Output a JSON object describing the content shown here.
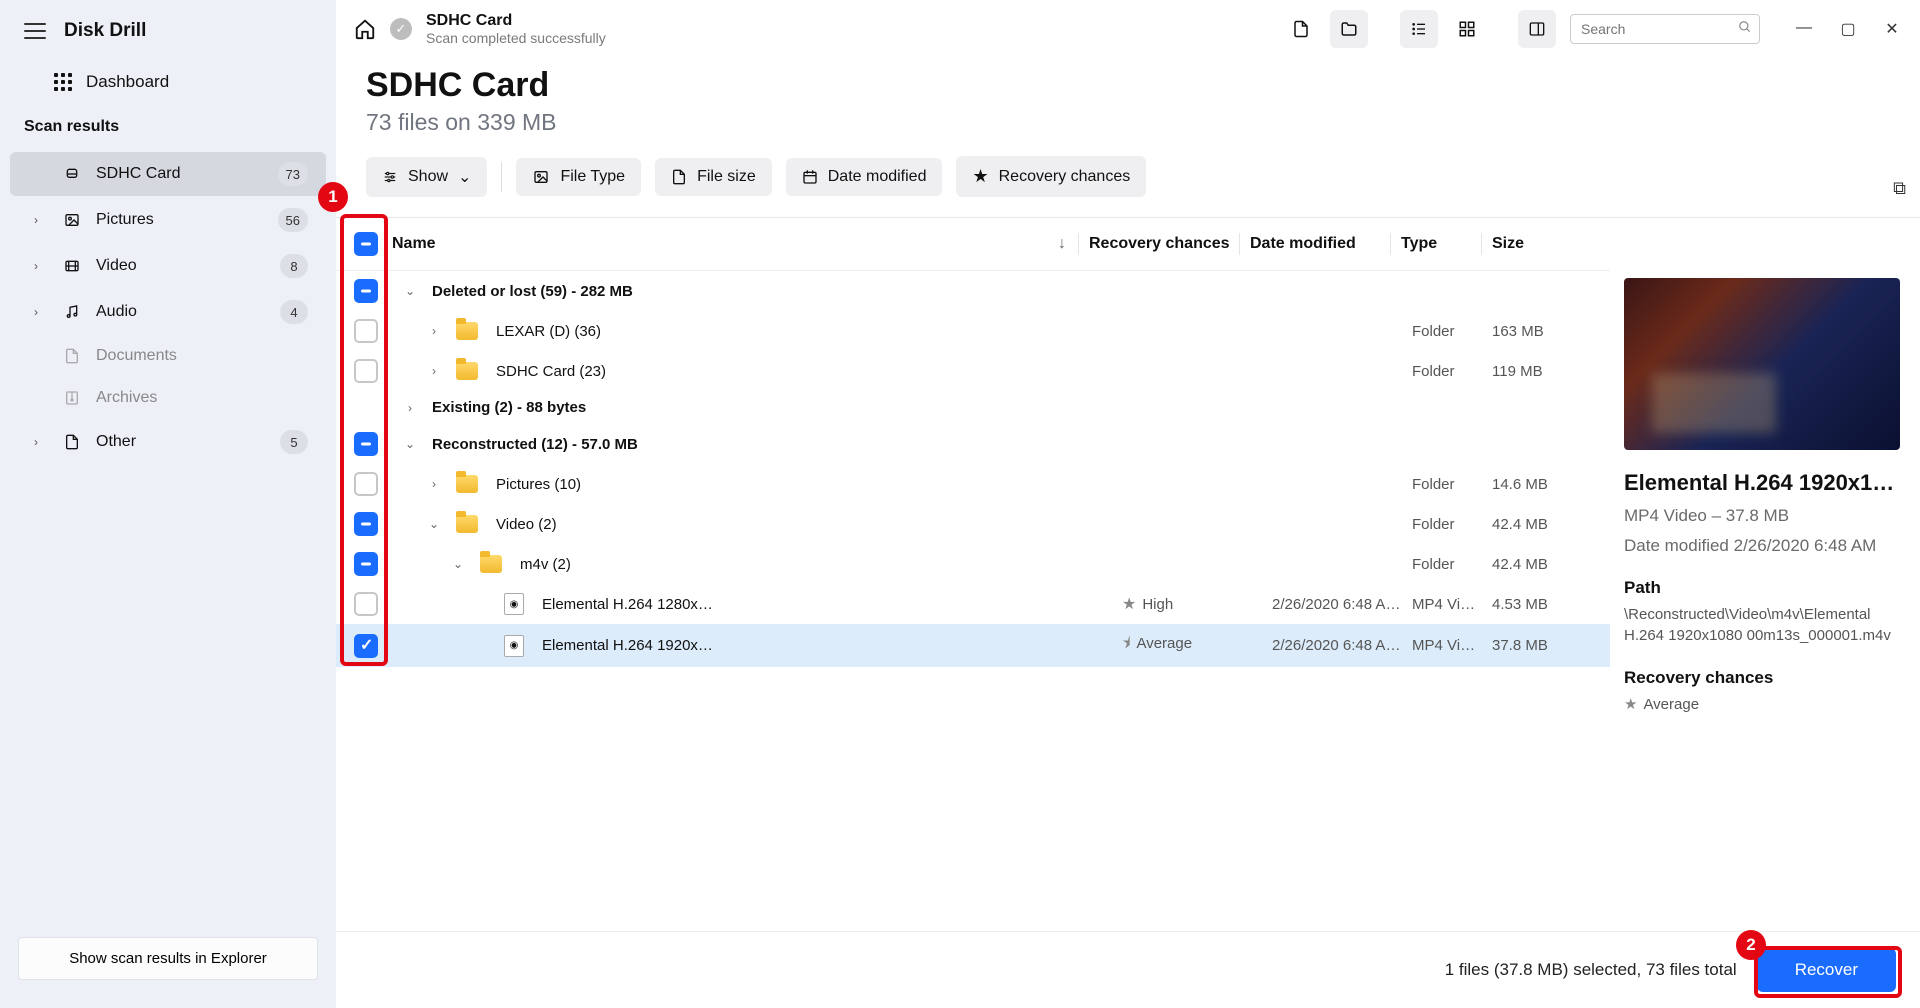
{
  "app_name": "Disk Drill",
  "sidebar": {
    "dashboard": "Dashboard",
    "section": "Scan results",
    "items": [
      {
        "label": "SDHC Card",
        "count": "73",
        "active": true,
        "icon": "drive"
      },
      {
        "label": "Pictures",
        "count": "56",
        "icon": "picture",
        "chev": true
      },
      {
        "label": "Video",
        "count": "8",
        "icon": "video",
        "chev": true
      },
      {
        "label": "Audio",
        "count": "4",
        "icon": "audio",
        "chev": true
      },
      {
        "label": "Documents",
        "count": "",
        "icon": "doc",
        "faded": true
      },
      {
        "label": "Archives",
        "count": "",
        "icon": "archive",
        "faded": true
      },
      {
        "label": "Other",
        "count": "5",
        "icon": "other",
        "chev": true
      }
    ],
    "explorer_btn": "Show scan results in Explorer"
  },
  "breadcrumb": {
    "title": "SDHC Card",
    "subtitle": "Scan completed successfully"
  },
  "header": {
    "title": "SDHC Card",
    "subtitle": "73 files on 339 MB"
  },
  "filters": {
    "show": "Show",
    "filetype": "File Type",
    "filesize": "File size",
    "datemod": "Date modified",
    "recchance": "Recovery chances"
  },
  "search_placeholder": "Search",
  "columns": {
    "name": "Name",
    "rec": "Recovery chances",
    "date": "Date modified",
    "type": "Type",
    "size": "Size"
  },
  "rows": [
    {
      "kind": "group",
      "check": "part",
      "expand": "v",
      "name": "Deleted or lost (59) - 282 MB"
    },
    {
      "kind": "folder",
      "check": "empty",
      "expand": ">",
      "indent": 1,
      "name": "LEXAR (D) (36)",
      "type": "Folder",
      "size": "163 MB"
    },
    {
      "kind": "folder",
      "check": "empty",
      "expand": ">",
      "indent": 1,
      "name": "SDHC Card (23)",
      "type": "Folder",
      "size": "119 MB"
    },
    {
      "kind": "group",
      "check": "",
      "expand": ">",
      "name": "Existing (2) - 88 bytes"
    },
    {
      "kind": "group",
      "check": "part",
      "expand": "v",
      "name": "Reconstructed (12) - 57.0 MB"
    },
    {
      "kind": "folder",
      "check": "empty",
      "expand": ">",
      "indent": 1,
      "name": "Pictures (10)",
      "type": "Folder",
      "size": "14.6 MB"
    },
    {
      "kind": "folder",
      "check": "part",
      "expand": "v",
      "indent": 1,
      "name": "Video (2)",
      "type": "Folder",
      "size": "42.4 MB"
    },
    {
      "kind": "folder",
      "check": "part",
      "expand": "v",
      "indent": 2,
      "name": "m4v (2)",
      "type": "Folder",
      "size": "42.4 MB"
    },
    {
      "kind": "file",
      "check": "empty",
      "indent": 3,
      "name": "Elemental H.264 1280x…",
      "rec": "High",
      "star": "full",
      "date": "2/26/2020 6:48 A…",
      "type": "MP4 Vi…",
      "size": "4.53 MB"
    },
    {
      "kind": "file",
      "check": "chk",
      "indent": 3,
      "name": "Elemental H.264 1920x…",
      "rec": "Average",
      "star": "half",
      "date": "2/26/2020 6:48 A…",
      "type": "MP4 Vi…",
      "size": "37.8 MB",
      "sel": true
    }
  ],
  "preview": {
    "title": "Elemental H.264 1920x10…",
    "line1": "MP4 Video – 37.8 MB",
    "line2": "Date modified 2/26/2020 6:48 AM",
    "path_h": "Path",
    "path": "\\Reconstructed\\Video\\m4v\\Elemental H.264 1920x1080 00m13s_000001.m4v",
    "rec_h": "Recovery chances",
    "rec": "Average"
  },
  "footer": {
    "status": "1 files (37.8 MB) selected, 73 files total",
    "recover": "Recover"
  },
  "anno": {
    "n1": "1",
    "n2": "2"
  }
}
